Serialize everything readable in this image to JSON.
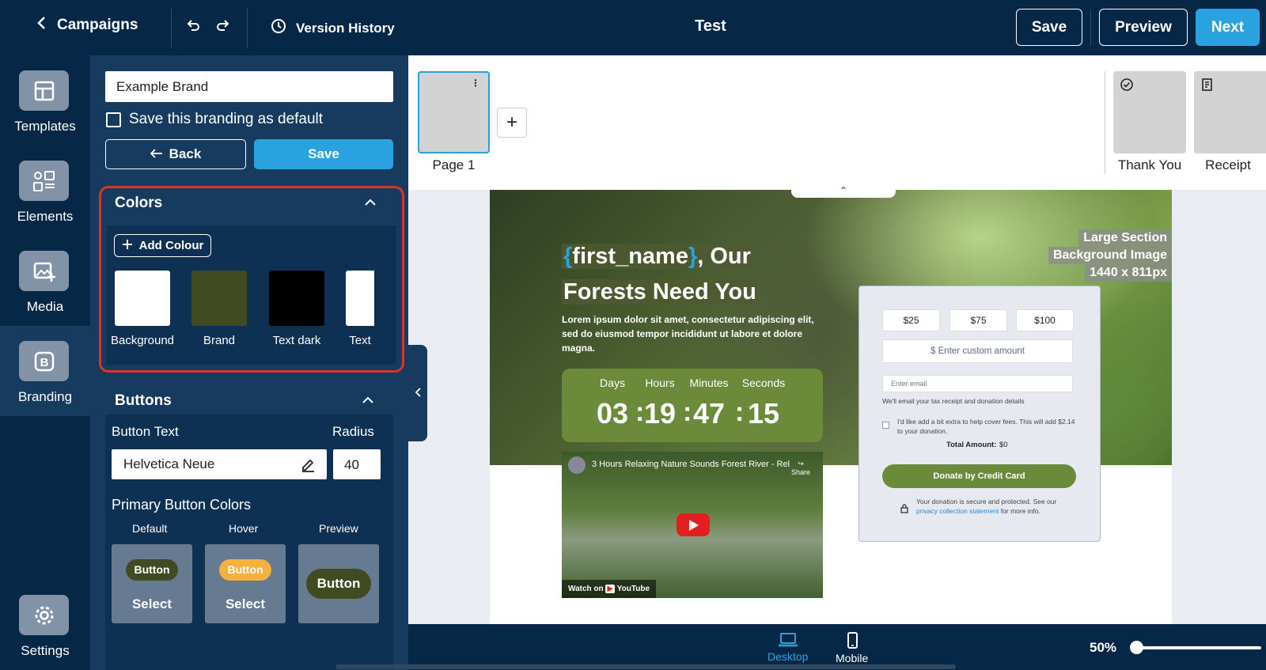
{
  "topbar": {
    "back_label": "Campaigns",
    "version_history": "Version History",
    "title": "Test",
    "save": "Save",
    "preview": "Preview",
    "next": "Next"
  },
  "rail": {
    "items": [
      {
        "label": "Templates"
      },
      {
        "label": "Elements"
      },
      {
        "label": "Media"
      },
      {
        "label": "Branding"
      },
      {
        "label": "Settings"
      }
    ]
  },
  "panel": {
    "brand_name": "Example Brand",
    "save_default": "Save this branding as default",
    "back": "Back",
    "save": "Save",
    "colors": {
      "title": "Colors",
      "add": "Add Colour",
      "swatches": [
        {
          "label": "Background",
          "color": "#ffffff"
        },
        {
          "label": "Brand",
          "color": "#404b21"
        },
        {
          "label": "Text dark",
          "color": "#000000"
        },
        {
          "label": "Text",
          "color": "#ffffff"
        }
      ]
    },
    "buttons": {
      "title": "Buttons",
      "button_text": "Button Text",
      "radius_label": "Radius",
      "font": "Helvetica Neue",
      "radius": "40",
      "primary_colors": "Primary Button Colors",
      "default": "Default",
      "hover": "Hover",
      "preview": "Preview",
      "button": "Button",
      "select": "Select",
      "default_color": "#404b21",
      "hover_color": "#f5b03d"
    }
  },
  "pages": {
    "page1": "Page 1",
    "thank_you": "Thank You",
    "receipt": "Receipt"
  },
  "canvas": {
    "title_tag_open": "{",
    "title_var": "first_name",
    "title_tag_close": "}",
    "title_rest1": ", Our",
    "title_line2": "Forests Need You",
    "body": "Lorem ipsum dolor sit amet, consectetur adipiscing elit, sed do eiusmod tempor incididunt ut labore et dolore magna.",
    "countdown": {
      "labels": [
        "Days",
        "Hours",
        "Minutes",
        "Seconds"
      ],
      "values": [
        "03",
        "19",
        "47",
        "15"
      ]
    },
    "video": {
      "title": "3 Hours Relaxing Nature Sounds Forest River - Rel...",
      "share": "Share",
      "watch_on": "Watch on",
      "youtube": "YouTube"
    },
    "bg_tag": [
      "Large Section",
      "Background Image",
      "1440 x 811px"
    ],
    "form": {
      "amounts": [
        "$25",
        "$75",
        "$100"
      ],
      "custom": "$ Enter custom amount",
      "email": "Enter email",
      "email_note": "We'll email your tax receipt and donation details",
      "fees": "I'd like add a bit extra to help cover fees. This will add $2.14 to your donation.",
      "total_label": "Total Amount:",
      "total_value": "$0",
      "donate": "Donate by Credit Card",
      "secure1": "Your donation is secure and protected. See our",
      "secure_link": "privacy collection statement",
      "secure2": "for more info."
    }
  },
  "bottom": {
    "desktop": "Desktop",
    "mobile": "Mobile",
    "zoom": "50%",
    "zoom_value": 0.05
  },
  "colors": {
    "navy": "#062846",
    "panel": "#173b5e",
    "accent": "#2aa2e0",
    "brand_green": "#6b8a3a",
    "highlight_red": "#d9332a"
  }
}
